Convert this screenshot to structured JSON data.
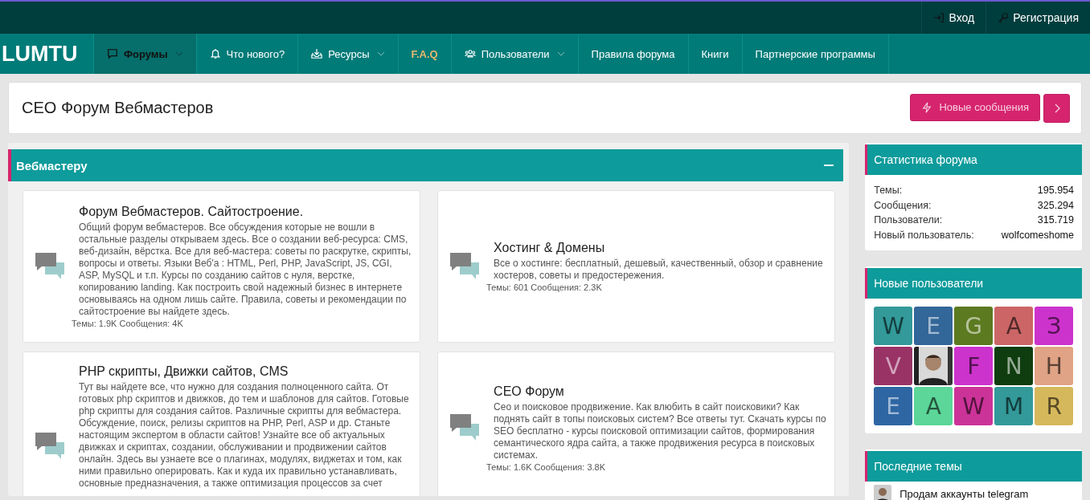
{
  "top_bar": {
    "links": [
      {
        "kind": "login",
        "label": "Вход"
      },
      {
        "kind": "key",
        "label": "Регистрация"
      }
    ]
  },
  "nav": {
    "logo": "LUMTU",
    "items": [
      {
        "kind": "chat",
        "label": "Форумы",
        "dropdown": true,
        "selected": true,
        "accent": false
      },
      {
        "kind": "bell",
        "label": "Что нового?",
        "dropdown": false,
        "selected": false,
        "accent": false
      },
      {
        "kind": "download",
        "label": "Ресурсы",
        "dropdown": true,
        "selected": false,
        "accent": false
      },
      {
        "kind": "plain",
        "label": "F.A.Q",
        "dropdown": false,
        "selected": false,
        "accent": true
      },
      {
        "kind": "users",
        "label": "Пользователи",
        "dropdown": true,
        "selected": false,
        "accent": false
      },
      {
        "kind": "plain",
        "label": "Правила форума",
        "dropdown": false,
        "selected": false,
        "accent": false
      },
      {
        "kind": "plain",
        "label": "Книги",
        "dropdown": false,
        "selected": false,
        "accent": false
      },
      {
        "kind": "plain",
        "label": "Партнерские программы",
        "dropdown": false,
        "selected": false,
        "accent": false
      }
    ]
  },
  "page_title": "СЕО Форум Вебмастеров",
  "new_posts_button": {
    "label": "Новые сообщения",
    "disabled": true
  },
  "section": {
    "title": "Вебмастеру",
    "expanded": true,
    "forums": [
      {
        "title": "Форум Вебмастеров. Сайтостроение.",
        "description": "Общий форум вебмастеров. Все обсуждения которые не вошли в остальные разделы открываем здесь. Все о создании веб-ресурса: CMS, веб-дизайн, вёрстка. Все для веб-мастера: советы по раскрутке, скрипты, вопросы и ответы. Языки Веб'а : HTML, Perl, PHP, JavaScript, JS, CGI, ASP, MySQL и т.п. Курсы по созданию сайтов с нуля, верстке, копированию landing. Как построить свой надежный бизнес в интернете основываясь на одном лишь сайте. Правила, советы и рекомендации по сайтостроение вы найдете здесь.",
        "stats": "Темы: 1.9K Сообщения: 4K"
      },
      {
        "title": "Хостинг & Домены",
        "description": "Все о хостинге: бесплатный, дешевый, качественный, обзор и сравнение хостеров, советы и предостережения.",
        "stats": "Темы: 601 Сообщения: 2.3K"
      },
      {
        "title": "PHP скрипты, Движки сайтов, CMS",
        "description": "Тут вы найдете все, что нужно для создания полноценного сайта. От готовых php скриптов и движков, до тем и шаблонов для сайтов. Готовые php скрипты для создания сайтов. Различные скрипты для вебмастера. Обсуждение, поиск, релизы скриптов на PHP, Perl, ASP и др. Станьте настоящим экспертом в области сайтов! Узнайте все об актуальных движках и скриптах, создании, обслуживании и продвижении сайтов онлайн. Здесь вы узнаете все о плагинах, модулях, виджетах и том, как ними правильно оперировать. Как и куда их правильно устанавливать, основные предназначения, а также оптимизация процессов за счет"
      },
      {
        "title": "СЕО Форум",
        "description": "Сео и поисковое продвижение. Как влюбить в сайт поисковики? Как поднять сайт в топы поисковых систем? Все ответы тут. Скачать курсы по SEO бесплатно - курсы поисковой оптимизации сайтов, формирования семантического ядра сайта, а также продвижения ресурса в поисковых системах.",
        "stats": "Темы: 1.6K Сообщения: 3.8K"
      }
    ]
  },
  "sidebar": {
    "stats": {
      "title": "Статистика форума",
      "rows": [
        {
          "label": "Темы:",
          "value": "195.954"
        },
        {
          "label": "Сообщения:",
          "value": "325.294"
        },
        {
          "label": "Пользователи:",
          "value": "315.719"
        },
        {
          "label": "Новый пользователь:",
          "value": "wolfcomeshome"
        }
      ]
    },
    "new_users": {
      "title": "Новые пользователи",
      "avatars": [
        {
          "kind": "letter",
          "letter": "W",
          "color": "#339999"
        },
        {
          "kind": "letter",
          "letter": "E",
          "color": "#336699"
        },
        {
          "kind": "letter",
          "letter": "G",
          "color": "#5c7a20"
        },
        {
          "kind": "letter",
          "letter": "A",
          "color": "#cc6666"
        },
        {
          "kind": "letter",
          "letter": "З",
          "color": "#cc33cc"
        },
        {
          "kind": "letter",
          "letter": "V",
          "color": "#993366"
        },
        {
          "kind": "picture"
        },
        {
          "kind": "letter",
          "letter": "F",
          "color": "#cc33cc"
        },
        {
          "kind": "letter",
          "letter": "N",
          "color": "#0f3d0f"
        },
        {
          "kind": "letter",
          "letter": "H",
          "color": "#e0a385"
        },
        {
          "kind": "letter",
          "letter": "E",
          "color": "#2e66a3"
        },
        {
          "kind": "letter",
          "letter": "A",
          "color": "#5cd699"
        },
        {
          "kind": "letter",
          "letter": "W",
          "color": "#cc3399"
        },
        {
          "kind": "letter",
          "letter": "M",
          "color": "#339999"
        },
        {
          "kind": "letter",
          "letter": "R",
          "color": "#d6b85c"
        }
      ]
    },
    "latest": {
      "title": "Последние темы",
      "items": [
        {
          "title": "Продам аккаунты telegram"
        }
      ]
    }
  }
}
